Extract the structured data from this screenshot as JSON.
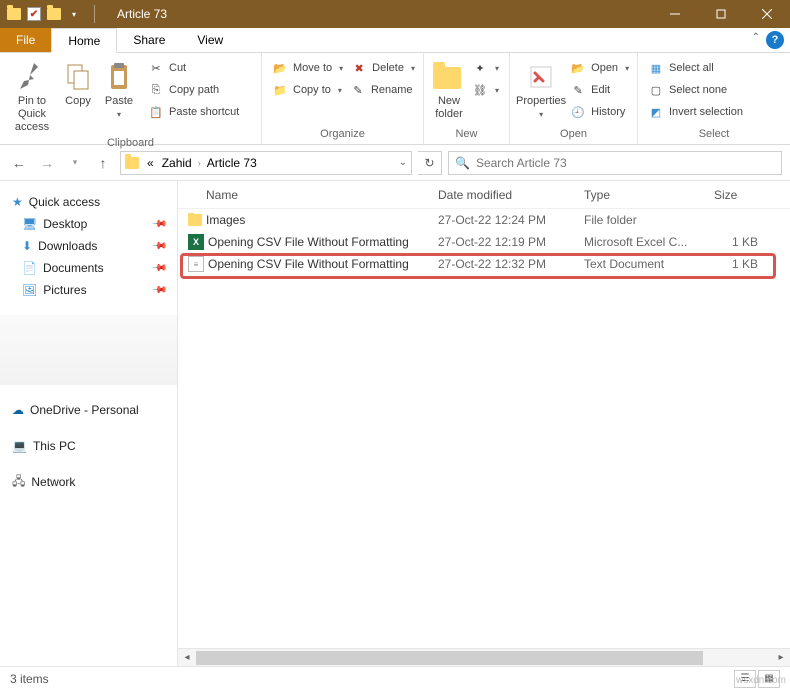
{
  "title": "Article 73",
  "tabs": {
    "file": "File",
    "home": "Home",
    "share": "Share",
    "view": "View"
  },
  "ribbon": {
    "clipboard": {
      "pin": "Pin to Quick access",
      "copy": "Copy",
      "paste": "Paste",
      "cut": "Cut",
      "copypath": "Copy path",
      "pasteshortcut": "Paste shortcut",
      "label": "Clipboard"
    },
    "organize": {
      "moveto": "Move to",
      "copyto": "Copy to",
      "delete": "Delete",
      "rename": "Rename",
      "label": "Organize"
    },
    "new": {
      "newfolder": "New folder",
      "newitem": "New item",
      "easyaccess": "Easy access",
      "label": "New"
    },
    "open": {
      "properties": "Properties",
      "open": "Open",
      "edit": "Edit",
      "history": "History",
      "label": "Open"
    },
    "select": {
      "selectall": "Select all",
      "selectnone": "Select none",
      "invert": "Invert selection",
      "label": "Select"
    }
  },
  "breadcrumb": {
    "p1": "Zahid",
    "p2": "Article 73",
    "prefix": "«"
  },
  "search": {
    "placeholder": "Search Article 73"
  },
  "nav": {
    "quick": "Quick access",
    "desktop": "Desktop",
    "downloads": "Downloads",
    "documents": "Documents",
    "pictures": "Pictures",
    "onedrive": "OneDrive - Personal",
    "thispc": "This PC",
    "network": "Network"
  },
  "columns": {
    "name": "Name",
    "date": "Date modified",
    "type": "Type",
    "size": "Size"
  },
  "rows": [
    {
      "name": "Images",
      "date": "27-Oct-22 12:24 PM",
      "type": "File folder",
      "size": "",
      "icon": "folder"
    },
    {
      "name": "Opening CSV File Without Formatting",
      "date": "27-Oct-22 12:19 PM",
      "type": "Microsoft Excel C...",
      "size": "1 KB",
      "icon": "excel"
    },
    {
      "name": "Opening CSV File Without Formatting",
      "date": "27-Oct-22 12:32 PM",
      "type": "Text Document",
      "size": "1 KB",
      "icon": "text"
    }
  ],
  "status": {
    "count": "3 items"
  },
  "watermark": "wsxdn.com"
}
